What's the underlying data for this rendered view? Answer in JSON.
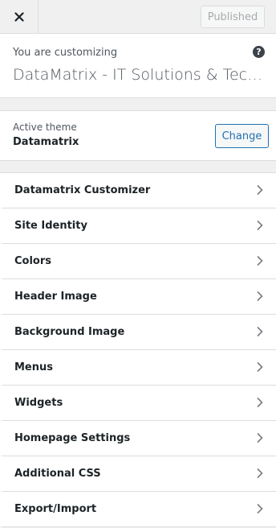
{
  "header": {
    "close_icon": "close-icon",
    "published_label": "Published"
  },
  "info": {
    "customizing_label": "You are customizing",
    "site_title": "DataMatrix - IT Solutions & Technology",
    "help_icon": "help-icon"
  },
  "theme": {
    "label": "Active theme",
    "name": "Datamatrix",
    "change_label": "Change"
  },
  "panels": [
    {
      "label": "Datamatrix Customizer"
    },
    {
      "label": "Site Identity"
    },
    {
      "label": "Colors"
    },
    {
      "label": "Header Image"
    },
    {
      "label": "Background Image"
    },
    {
      "label": "Menus"
    },
    {
      "label": "Widgets"
    },
    {
      "label": "Homepage Settings"
    },
    {
      "label": "Additional CSS"
    },
    {
      "label": "Export/Import"
    }
  ],
  "colors": {
    "accent": "#2271b1",
    "background": "#f0f0f1",
    "border": "#dcdcde"
  }
}
